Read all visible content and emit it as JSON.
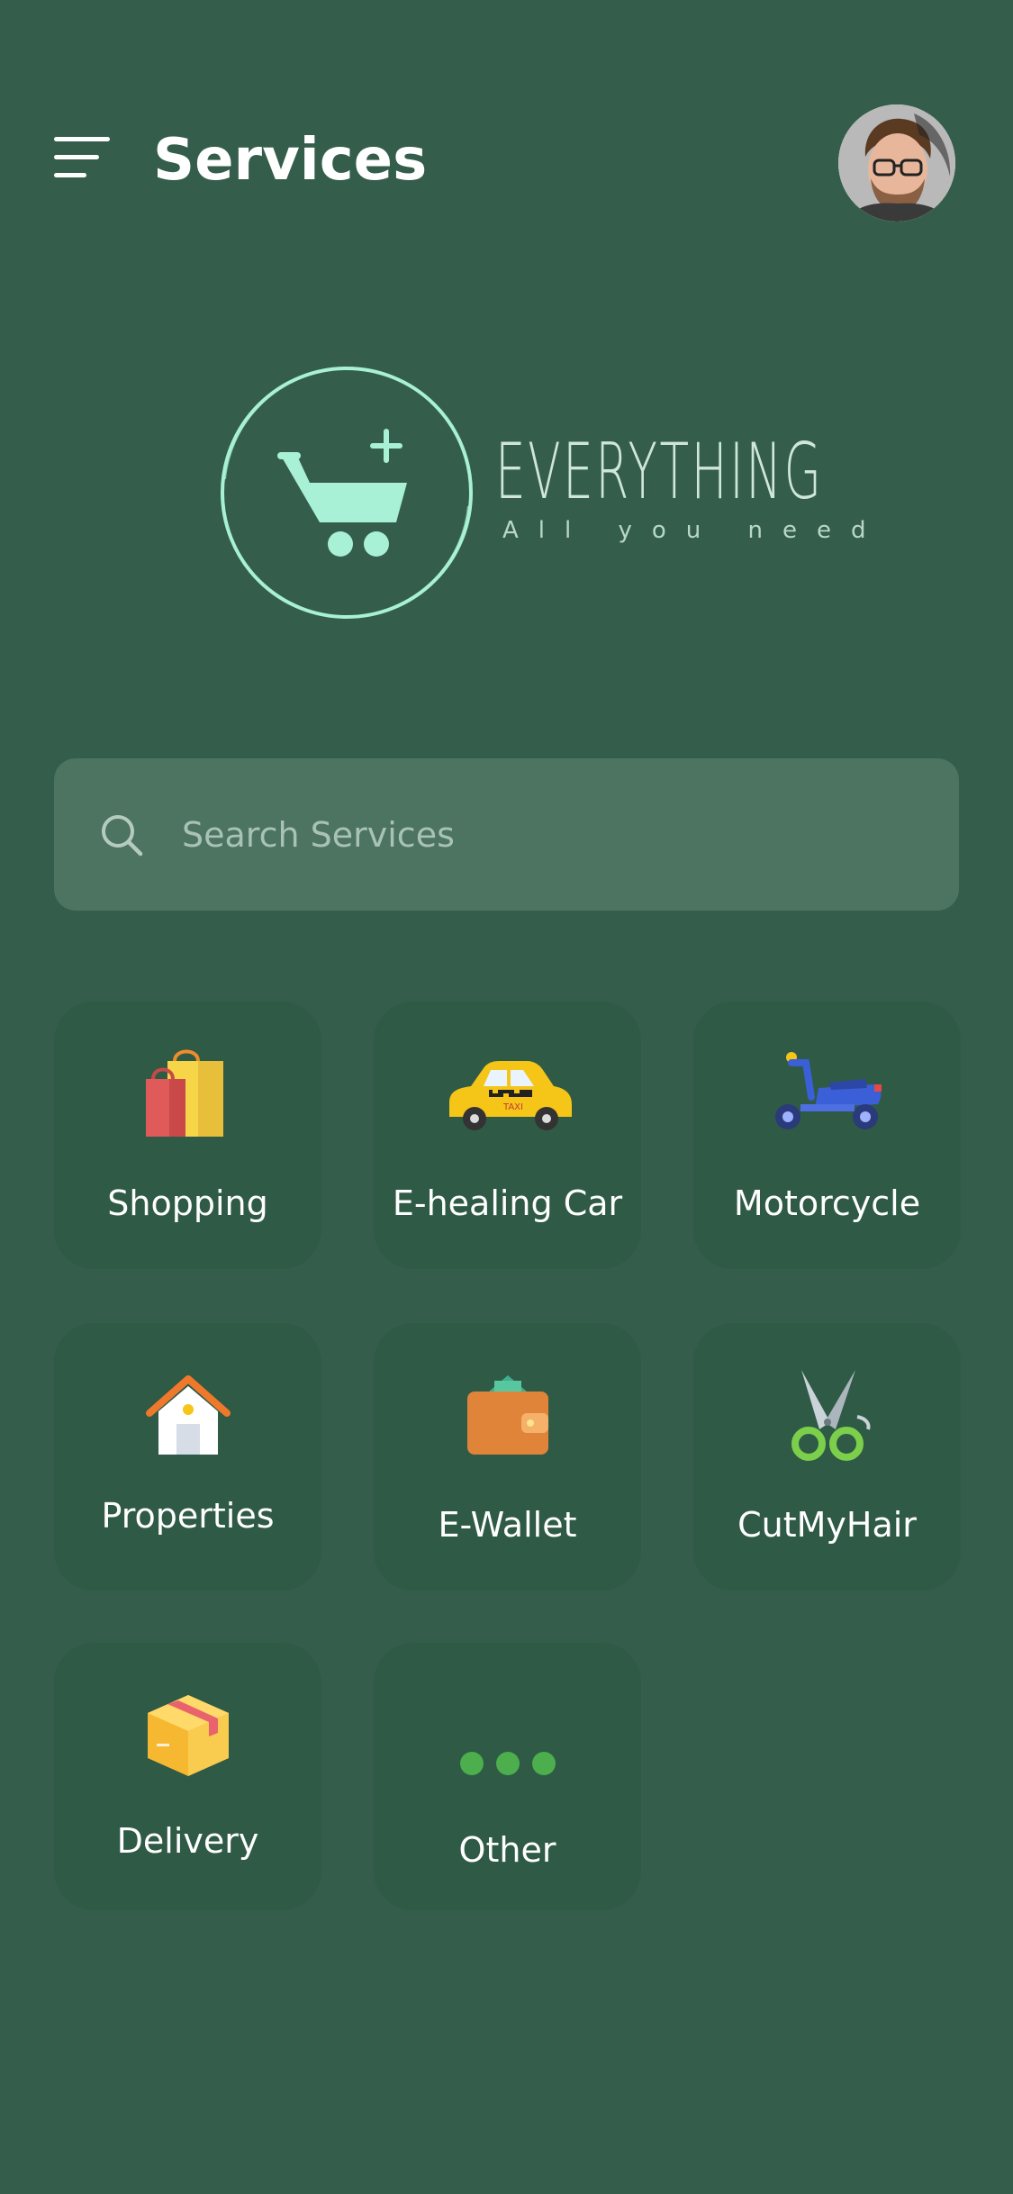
{
  "header": {
    "title": "Services",
    "menu_icon": "menu-icon",
    "avatar_icon": "user-avatar"
  },
  "logo": {
    "wordmark": "EVERYTHING",
    "tagline": "All you need",
    "icon": "cart-plus-icon",
    "color": "#a8f0d6"
  },
  "search": {
    "placeholder": "Search Services",
    "value": "",
    "icon": "search-icon"
  },
  "services": [
    {
      "label": "Shopping",
      "icon": "shopping-bags-icon"
    },
    {
      "label": "E-healing Car",
      "icon": "taxi-icon"
    },
    {
      "label": "Motorcycle",
      "icon": "scooter-icon"
    },
    {
      "label": "Properties",
      "icon": "house-icon"
    },
    {
      "label": "E-Wallet",
      "icon": "wallet-icon"
    },
    {
      "label": "CutMyHair",
      "icon": "scissors-icon"
    },
    {
      "label": "Delivery",
      "icon": "package-icon"
    },
    {
      "label": "Other",
      "icon": "more-dots-icon"
    }
  ],
  "colors": {
    "background": "#345e4b",
    "tile": "#2f5a46",
    "search_bg": "#4c7461",
    "accent_green": "#4cae4c"
  }
}
